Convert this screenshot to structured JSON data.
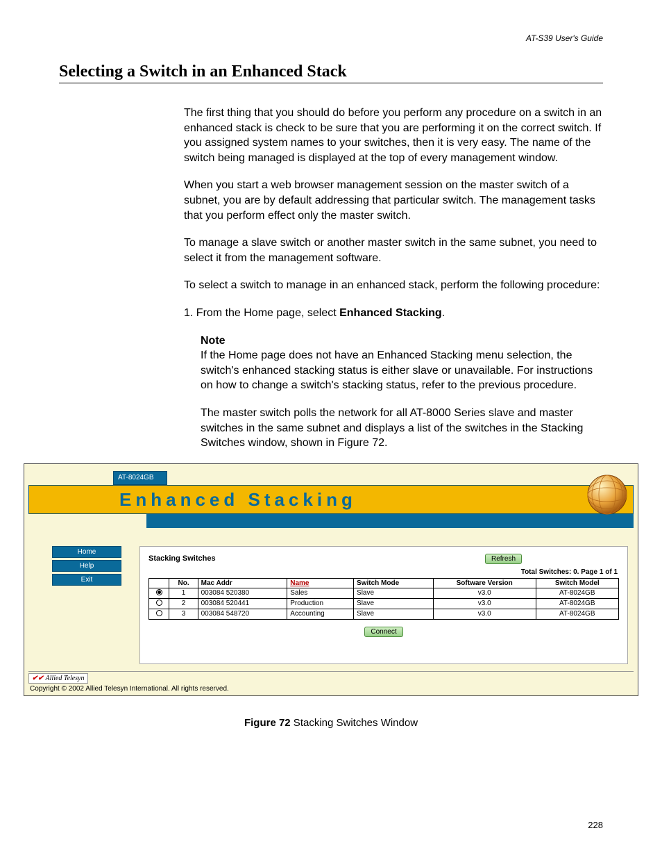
{
  "header": {
    "guide": "AT-S39 User's Guide"
  },
  "title": "Selecting a Switch in an Enhanced Stack",
  "p1": "The first thing that you should do before you perform any procedure on a switch in an enhanced stack is check to be sure that you are performing it on the correct switch. If you assigned system names to your switches, then it is very easy. The name of the switch being managed is displayed at the top of every management window.",
  "p2": "When you start a web browser management session on the master switch of a subnet, you are by default addressing that particular switch. The management tasks that you perform effect only the master switch.",
  "p3": "To manage a slave switch or another master switch in the same subnet, you need to select it from the management software.",
  "p4": "To select a switch to manage in an enhanced stack, perform the following procedure:",
  "step1_prefix": "1.   From the Home page, select ",
  "step1_bold": "Enhanced Stacking",
  "step1_suffix": ".",
  "note": {
    "label": "Note",
    "body": "If the Home page does not have an Enhanced Stacking menu selection, the switch's enhanced stacking status is either slave or unavailable. For instructions on how to change a switch's stacking status, refer to the previous procedure."
  },
  "p5": "The master switch polls the network for all AT-8000 Series slave and master switches in the same subnet and displays a list of the switches in the Stacking Switches window, shown in Figure 72.",
  "app": {
    "tab": "AT-8024GB",
    "title": "Enhanced Stacking",
    "sidebar": {
      "items": [
        "Home",
        "Help",
        "Exit"
      ]
    },
    "panel": {
      "title": "Stacking Switches",
      "refresh": "Refresh",
      "total": "Total Switches: 0. Page 1 of 1",
      "headers": {
        "sel": "",
        "no": "No.",
        "mac": "Mac Addr",
        "name": "Name",
        "mode": "Switch Mode",
        "ver": "Software Version",
        "model": "Switch Model"
      },
      "rows": [
        {
          "sel": true,
          "no": "1",
          "mac": "003084 520380",
          "name": "Sales",
          "mode": "Slave",
          "ver": "v3.0",
          "model": "AT-8024GB"
        },
        {
          "sel": false,
          "no": "2",
          "mac": "003084 520441",
          "name": "Production",
          "mode": "Slave",
          "ver": "v3.0",
          "model": "AT-8024GB"
        },
        {
          "sel": false,
          "no": "3",
          "mac": "003084 548720",
          "name": "Accounting",
          "mode": "Slave",
          "ver": "v3.0",
          "model": "AT-8024GB"
        }
      ],
      "connect": "Connect"
    },
    "logo": "Allied Telesyn",
    "copyright": "Copyright © 2002 Allied Telesyn International. All rights reserved."
  },
  "figure": {
    "label": "Figure 72",
    "caption": "  Stacking Switches Window"
  },
  "page_number": "228"
}
